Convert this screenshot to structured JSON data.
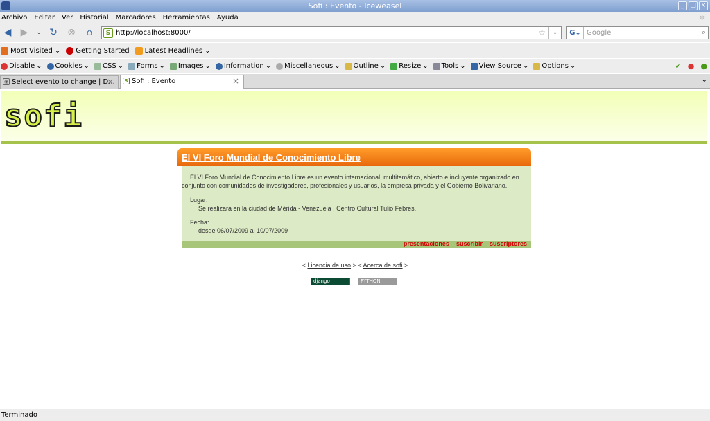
{
  "window": {
    "title": "Sofi : Evento - Iceweasel"
  },
  "menubar": {
    "items": [
      "Archivo",
      "Editar",
      "Ver",
      "Historial",
      "Marcadores",
      "Herramientas",
      "Ayuda"
    ]
  },
  "navbar": {
    "url": "http://localhost:8000/",
    "search_placeholder": "Google"
  },
  "bookmarks": {
    "items": [
      "Most Visited",
      "Getting Started",
      "Latest Headlines"
    ]
  },
  "webdev": {
    "items": [
      "Disable",
      "Cookies",
      "CSS",
      "Forms",
      "Images",
      "Information",
      "Miscellaneous",
      "Outline",
      "Resize",
      "Tools",
      "View Source",
      "Options"
    ]
  },
  "tabs": [
    {
      "label": "Select evento to change | D..."
    },
    {
      "label": "Sofi : Evento"
    }
  ],
  "page": {
    "logo": "sofi",
    "event": {
      "title": "El VI Foro Mundial de Conocimiento Libre",
      "description": "El VI Foro Mundial de Conocimiento Libre es un evento internacional, multitemático, abierto e incluyente organizado en conjunto con comunidades de investigadores, profesionales y usuarios, la empresa privada y el Gobierno Bolivariano.",
      "lugar_label": "Lugar:",
      "lugar_value": "Se realizará en la ciudad de Mérida - Venezuela , Centro Cultural Tulio Febres.",
      "fecha_label": "Fecha:",
      "fecha_value": "desde 06/07/2009 al 10/07/2009",
      "links": [
        "presentaciones",
        "suscribir",
        "suscriptores"
      ]
    },
    "footer": {
      "licencia": "Licencia de uso",
      "acerca": "Acerca de sofi",
      "badge_django": "django POWERED",
      "badge_python": "PYTHON"
    }
  },
  "status": {
    "text": "Terminado"
  }
}
